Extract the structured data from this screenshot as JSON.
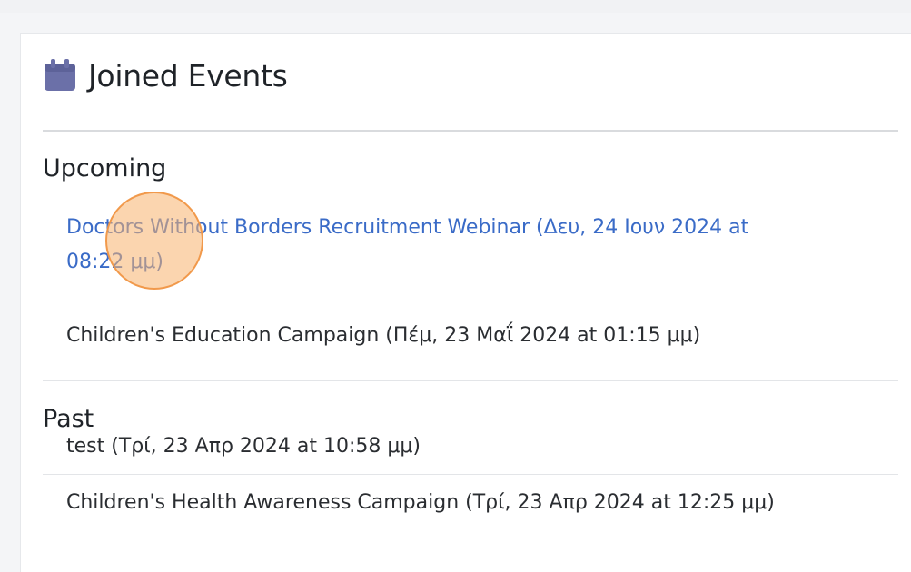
{
  "panel": {
    "title": "Joined Events",
    "icon": "calendar-icon",
    "icon_color": "#6b70a8"
  },
  "sections": {
    "upcoming": {
      "title": "Upcoming",
      "events": [
        {
          "text": "Doctors Without Borders Recruitment Webinar (Δευ, 24 Ιουν 2024 at",
          "text2": "08:22 μμ)"
        },
        {
          "text": "Children's Education Campaign (Πέμ, 23 Μαΐ 2024 at 01:15 μμ)"
        }
      ]
    },
    "past": {
      "title": "Past",
      "events": [
        {
          "text": "test (Τρί, 23 Απρ 2024 at 10:58 μμ)"
        },
        {
          "text": "Children's Health Awareness Campaign (Τρί, 23 Απρ 2024 at 12:25 μμ)"
        }
      ]
    }
  },
  "colors": {
    "link": "#3a6bc7",
    "text": "#2a2d31",
    "cursor_highlight": "#f7b26e"
  }
}
